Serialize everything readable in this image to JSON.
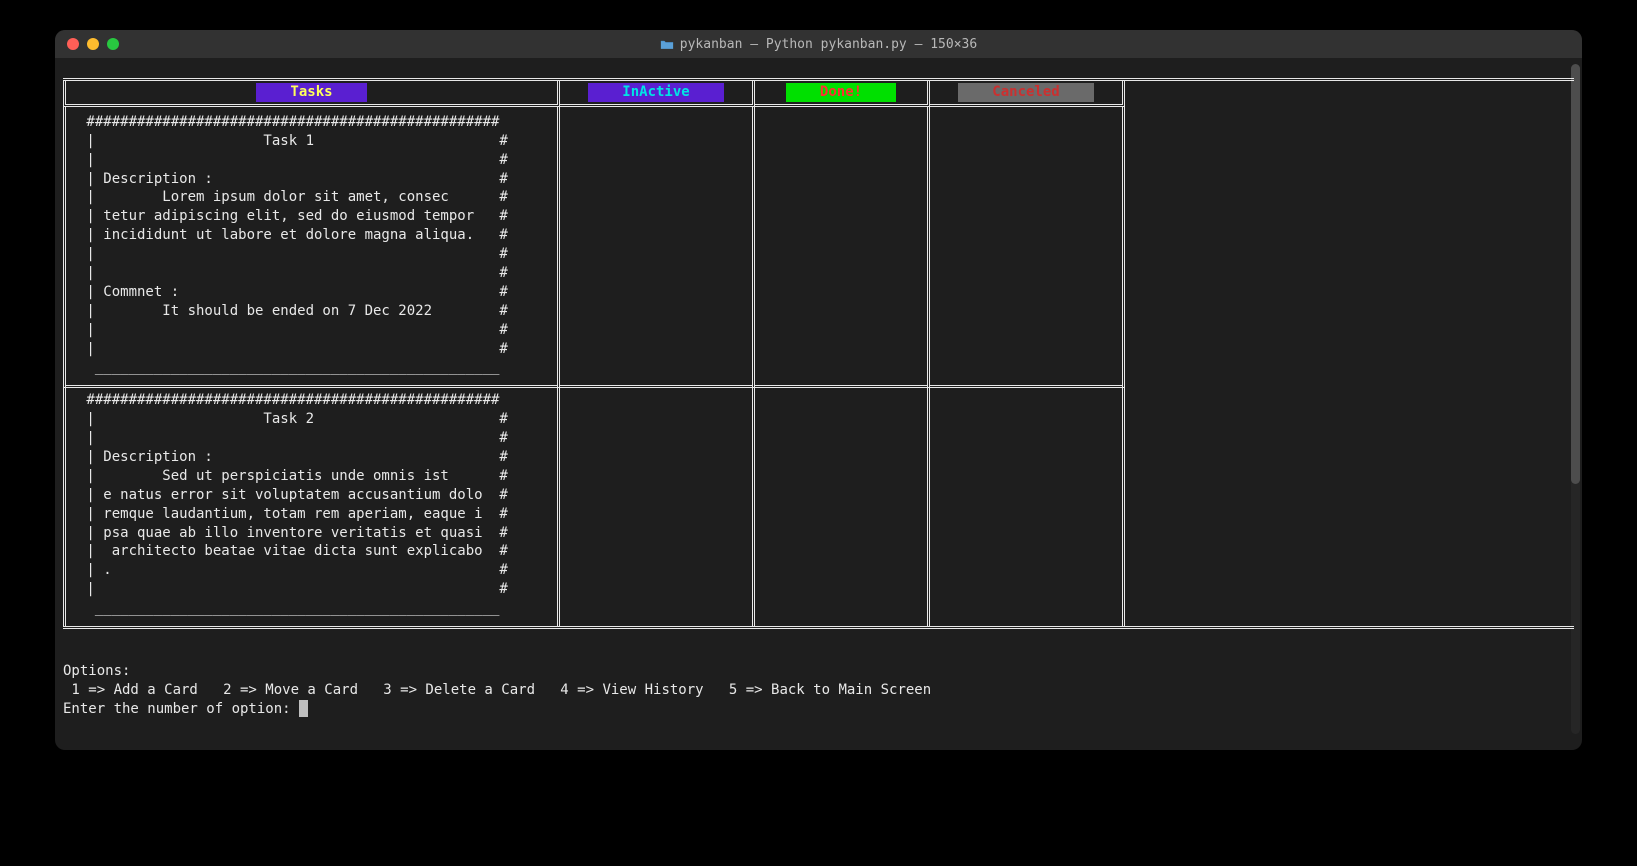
{
  "window": {
    "title": "pykanban — Python pykanban.py — 150×36"
  },
  "columns": {
    "tasks": {
      "label": "Tasks"
    },
    "inactive": {
      "label": "InActive"
    },
    "done": {
      "label": "Done!"
    },
    "canceled": {
      "label": "Canceled"
    }
  },
  "cards": [
    {
      "ascii": " #################################################\n |                    Task 1                      #\n |                                                #\n | Description :                                  #\n |        Lorem ipsum dolor sit amet, consec      #\n | tetur adipiscing elit, sed do eiusmod tempor   #\n | incididunt ut labore et dolore magna aliqua.   #\n |                                                #\n |                                                #\n | Commnet :                                      #\n |        It should be ended on 7 Dec 2022        #\n |                                                #\n |                                                #\n  ________________________________________________",
      "title": "Task 1",
      "description": "Lorem ipsum dolor sit amet, consectetur adipiscing elit, sed do eiusmod tempor incididunt ut labore et dolore magna aliqua.",
      "comment": "It should be ended on 7 Dec 2022"
    },
    {
      "ascii": " #################################################\n |                    Task 2                      #\n |                                                #\n | Description :                                  #\n |        Sed ut perspiciatis unde omnis ist      #\n | e natus error sit voluptatem accusantium dolo  #\n | remque laudantium, totam rem aperiam, eaque i  #\n | psa quae ab illo inventore veritatis et quasi  #\n |  architecto beatae vitae dicta sunt explicabo  #\n | .                                              #\n |                                                #\n  ________________________________________________",
      "title": "Task 2",
      "description": "Sed ut perspiciatis unde omnis iste natus error sit voluptatem accusantium doloremque laudantium, totam rem aperiam, eaque ipsa quae ab illo inventore veritatis et quasi architecto beatae vitae dicta sunt explicabo.",
      "comment": ""
    }
  ],
  "options": {
    "header": "Options:",
    "items": [
      {
        "key": "1",
        "label": "Add a Card"
      },
      {
        "key": "2",
        "label": "Move a Card"
      },
      {
        "key": "3",
        "label": "Delete a Card"
      },
      {
        "key": "4",
        "label": "View History"
      },
      {
        "key": "5",
        "label": "Back to Main Screen"
      }
    ],
    "line": " 1 => Add a Card   2 => Move a Card   3 => Delete a Card   4 => View History   5 => Back to Main Screen",
    "prompt": "Enter the number of option: "
  }
}
